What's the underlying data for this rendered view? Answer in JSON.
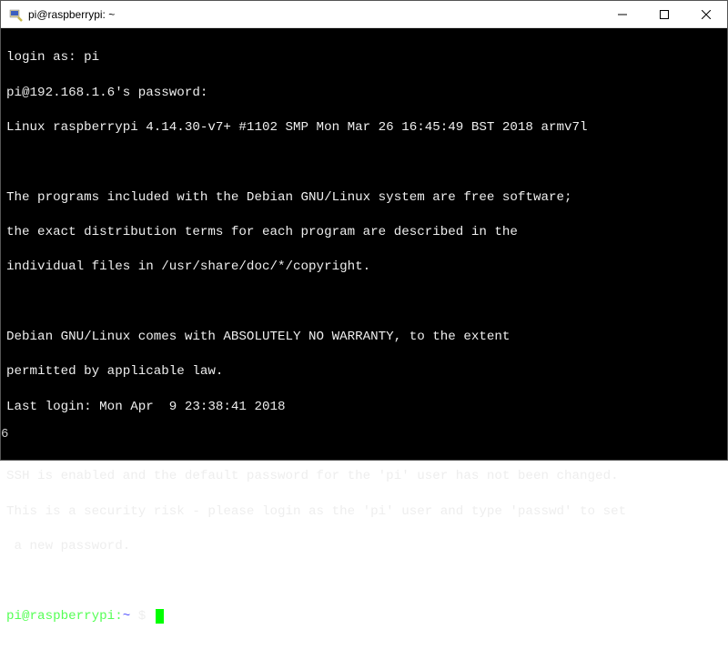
{
  "window": {
    "title": "pi@raspberrypi: ~",
    "controls": {
      "minimize": "—",
      "maximize": "☐",
      "close": "✕"
    }
  },
  "terminal": {
    "lines": {
      "login_as": "login as: pi",
      "password_prompt": "pi@192.168.1.6's password:",
      "kernel": "Linux raspberrypi 4.14.30-v7+ #1102 SMP Mon Mar 26 16:45:49 BST 2018 armv7l",
      "motd1": "The programs included with the Debian GNU/Linux system are free software;",
      "motd2": "the exact distribution terms for each program are described in the",
      "motd3": "individual files in /usr/share/doc/*/copyright.",
      "warranty1": "Debian GNU/Linux comes with ABSOLUTELY NO WARRANTY, to the extent",
      "warranty2": "permitted by applicable law.",
      "last_login": "Last login: Mon Apr  9 23:38:41 2018",
      "ssh1": "SSH is enabled and the default password for the 'pi' user has not been changed.",
      "ssh2": "This is a security risk - please login as the 'pi' user and type 'passwd' to set",
      "ssh3": " a new password."
    },
    "prompt": {
      "user_host": "pi@raspberrypi",
      "sep": ":",
      "cwd": "~",
      "dollar": " $ "
    },
    "scroll_indicator": "6"
  }
}
